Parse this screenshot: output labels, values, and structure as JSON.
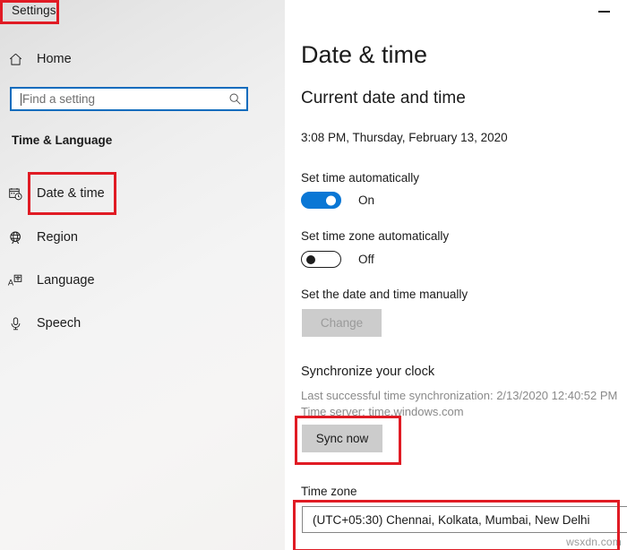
{
  "window": {
    "title": "Settings",
    "minimize_icon": "minimize-icon"
  },
  "sidebar": {
    "home": {
      "label": "Home",
      "icon": "home-icon"
    },
    "search": {
      "placeholder": "Find a setting",
      "value": "",
      "icon": "search-icon"
    },
    "group_heading": "Time & Language",
    "items": [
      {
        "label": "Date & time",
        "icon": "calendar-clock-icon"
      },
      {
        "label": "Region",
        "icon": "globe-icon"
      },
      {
        "label": "Language",
        "icon": "language-icon"
      },
      {
        "label": "Speech",
        "icon": "microphone-icon"
      }
    ]
  },
  "main": {
    "page_title": "Date & time",
    "section_current": "Current date and time",
    "current_datetime": "3:08 PM, Thursday, February 13, 2020",
    "set_time_label": "Set time automatically",
    "set_time_state": "On",
    "set_timezone_label": "Set time zone automatically",
    "set_timezone_state": "Off",
    "set_manual_label": "Set the date and time manually",
    "change_button": "Change",
    "section_sync": "Synchronize your clock",
    "sync_status_line_1": "Last successful time synchronization: 2/13/2020 12:40:52 PM",
    "sync_status_line_2": "Time server: time.windows.com",
    "sync_now_button": "Sync now",
    "timezone_label": "Time zone",
    "timezone_value": "(UTC+05:30) Chennai, Kolkata, Mumbai, New Delhi"
  },
  "annotations": {
    "color": "#e01b24",
    "targets": [
      "settings-title",
      "date-time-nav-item",
      "sync-now-button",
      "timezone-dropdown"
    ]
  },
  "watermark": "wsxdn.com",
  "colors": {
    "accent_blue": "#0a77d5",
    "search_border_blue": "#0f6cbd",
    "button_grey": "#cccccc",
    "annotation_red": "#e01b24"
  }
}
